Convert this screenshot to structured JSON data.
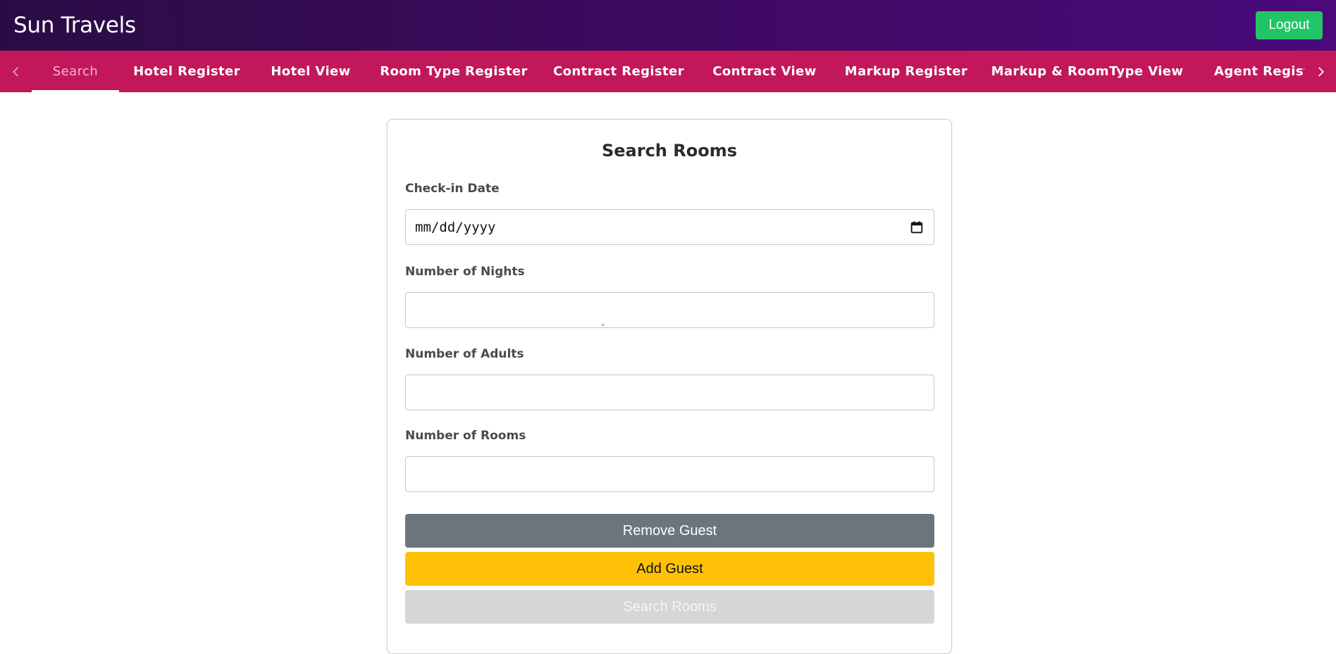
{
  "header": {
    "app_title": "Sun Travels",
    "logout_label": "Logout"
  },
  "nav": {
    "tabs": [
      {
        "label": "Search",
        "active": true
      },
      {
        "label": "Hotel Register",
        "active": false
      },
      {
        "label": "Hotel View",
        "active": false
      },
      {
        "label": "Room Type Register",
        "active": false
      },
      {
        "label": "Contract Register",
        "active": false
      },
      {
        "label": "Contract View",
        "active": false
      },
      {
        "label": "Markup Register",
        "active": false
      },
      {
        "label": "Markup & RoomType View",
        "active": false
      },
      {
        "label": "Agent Registe",
        "active": false
      }
    ],
    "scroll_left_icon": "chevron-left-icon",
    "scroll_right_icon": "chevron-right-icon"
  },
  "form": {
    "title": "Search Rooms",
    "checkin_label": "Check-in Date",
    "checkin_value": "mm/dd/yyyy",
    "nights_label": "Number of Nights",
    "nights_value": "",
    "adults_label": "Number of Adults",
    "adults_value": "",
    "rooms_label": "Number of Rooms",
    "rooms_value": "",
    "remove_guest_label": "Remove Guest",
    "add_guest_label": "Add Guest",
    "search_rooms_label": "Search Rooms"
  },
  "colors": {
    "header_gradient_start": "#2a0c45",
    "header_gradient_end": "#4a0a7a",
    "nav_background": "#c2185b",
    "logout_button": "#22c565",
    "remove_guest_button": "#6c757d",
    "add_guest_button": "#ffc107",
    "search_rooms_button_disabled": "#d6d6d6"
  }
}
